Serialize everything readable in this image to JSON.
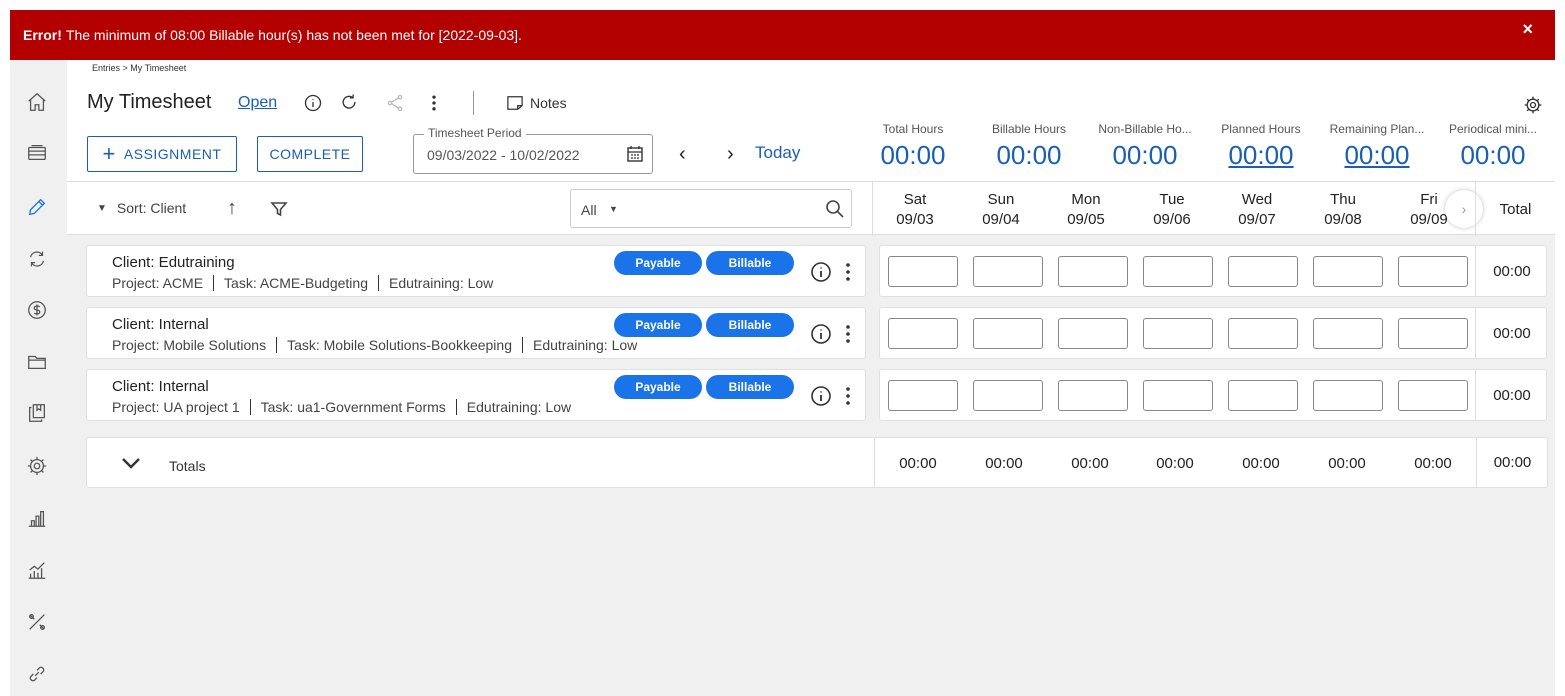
{
  "error": {
    "label": "Error!",
    "message": "The minimum of 08:00 Billable hour(s) has not been met for [2022-09-03].",
    "close": "×"
  },
  "breadcrumb": "Entries > My Timesheet",
  "page": {
    "title": "My Timesheet",
    "status": "Open",
    "notes_label": "Notes"
  },
  "actions": {
    "assignment_label": "ASSIGNMENT",
    "complete_label": "COMPLETE",
    "period_label": "Timesheet Period",
    "period_value": "09/03/2022 - 10/02/2022",
    "today_label": "Today"
  },
  "summary": [
    {
      "label": "Total Hours",
      "value": "00:00",
      "link": false
    },
    {
      "label": "Billable Hours",
      "value": "00:00",
      "link": false
    },
    {
      "label": "Non-Billable Ho...",
      "value": "00:00",
      "link": false
    },
    {
      "label": "Planned Hours",
      "value": "00:00",
      "link": true
    },
    {
      "label": "Remaining Plan...",
      "value": "00:00",
      "link": true
    },
    {
      "label": "Periodical mini...",
      "value": "00:00",
      "link": false
    }
  ],
  "grid": {
    "sort_label": "Sort: Client",
    "filter_value": "All",
    "total_label": "Total",
    "days": [
      {
        "day": "Sat",
        "date": "09/03"
      },
      {
        "day": "Sun",
        "date": "09/04"
      },
      {
        "day": "Mon",
        "date": "09/05"
      },
      {
        "day": "Tue",
        "date": "09/06"
      },
      {
        "day": "Wed",
        "date": "09/07"
      },
      {
        "day": "Thu",
        "date": "09/08"
      },
      {
        "day": "Fri",
        "date": "09/09"
      }
    ]
  },
  "rows": [
    {
      "client": "Client: Edutraining",
      "project": "Project: ACME",
      "task": "Task: ACME-Budgeting",
      "tag": "Edutraining: Low",
      "badges": [
        "Payable",
        "Billable"
      ],
      "total": "00:00"
    },
    {
      "client": "Client: Internal",
      "project": "Project: Mobile Solutions",
      "task": "Task: Mobile Solutions-Bookkeeping",
      "tag": "Edutraining: Low",
      "badges": [
        "Payable",
        "Billable"
      ],
      "total": "00:00"
    },
    {
      "client": "Client: Internal",
      "project": "Project: UA project 1",
      "task": "Task: ua1-Government Forms",
      "tag": "Edutraining: Low",
      "badges": [
        "Payable",
        "Billable"
      ],
      "total": "00:00"
    }
  ],
  "totals": {
    "label": "Totals",
    "days": [
      "00:00",
      "00:00",
      "00:00",
      "00:00",
      "00:00",
      "00:00",
      "00:00"
    ],
    "grand": "00:00"
  },
  "colors": {
    "error_bg": "#b30000",
    "accent": "#1a5fb4",
    "badge": "#1a73e8"
  }
}
